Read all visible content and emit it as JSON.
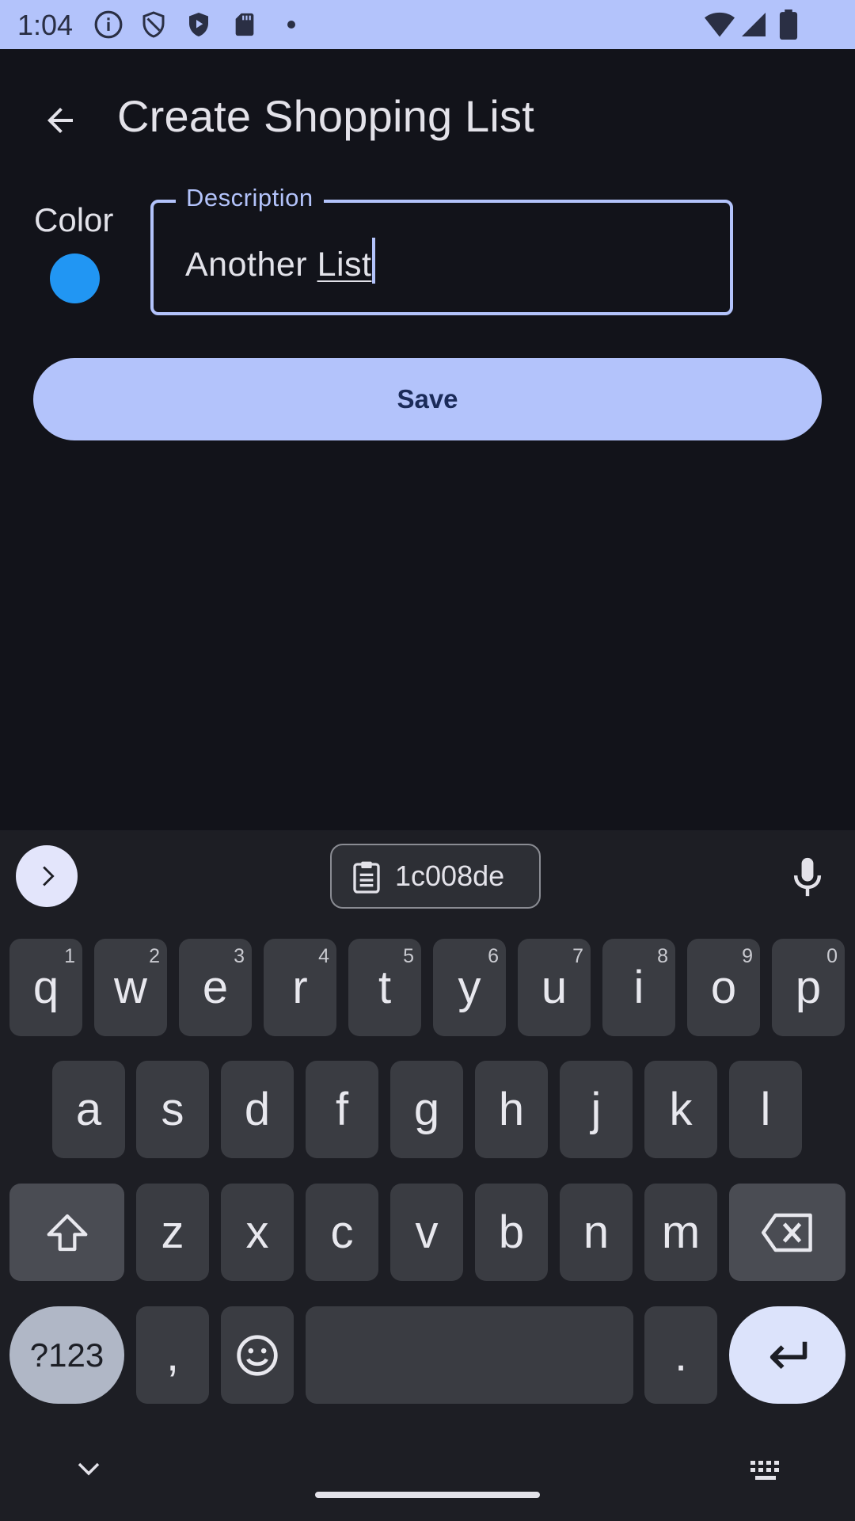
{
  "status_bar": {
    "time": "1:04",
    "icons": [
      "info-icon",
      "shield-icon",
      "play-shield-icon",
      "sd-card-icon",
      "dot-icon",
      "wifi-icon",
      "signal-icon",
      "battery-icon"
    ]
  },
  "app_bar": {
    "title": "Create Shopping List",
    "back_icon": "arrow-back-icon"
  },
  "form": {
    "color_label": "Color",
    "color_value": "#2196F3",
    "description_label": "Description",
    "description_value_plain": "Another ",
    "description_value_composing": "List"
  },
  "save_button": {
    "label": "Save"
  },
  "keyboard": {
    "clipboard_text": "1c008de",
    "row1": [
      {
        "key": "q",
        "hint": "1"
      },
      {
        "key": "w",
        "hint": "2"
      },
      {
        "key": "e",
        "hint": "3"
      },
      {
        "key": "r",
        "hint": "4"
      },
      {
        "key": "t",
        "hint": "5"
      },
      {
        "key": "y",
        "hint": "6"
      },
      {
        "key": "u",
        "hint": "7"
      },
      {
        "key": "i",
        "hint": "8"
      },
      {
        "key": "o",
        "hint": "9"
      },
      {
        "key": "p",
        "hint": "0"
      }
    ],
    "row2": [
      "a",
      "s",
      "d",
      "f",
      "g",
      "h",
      "j",
      "k",
      "l"
    ],
    "row3": [
      "z",
      "x",
      "c",
      "v",
      "b",
      "n",
      "m"
    ],
    "symbols_label": "?123",
    "comma_label": ",",
    "period_label": "."
  },
  "colors": {
    "background": "#12131A",
    "accent": "#B3C3FB",
    "keyboard_bg": "#1D1E24",
    "key_bg": "#3A3C42"
  }
}
